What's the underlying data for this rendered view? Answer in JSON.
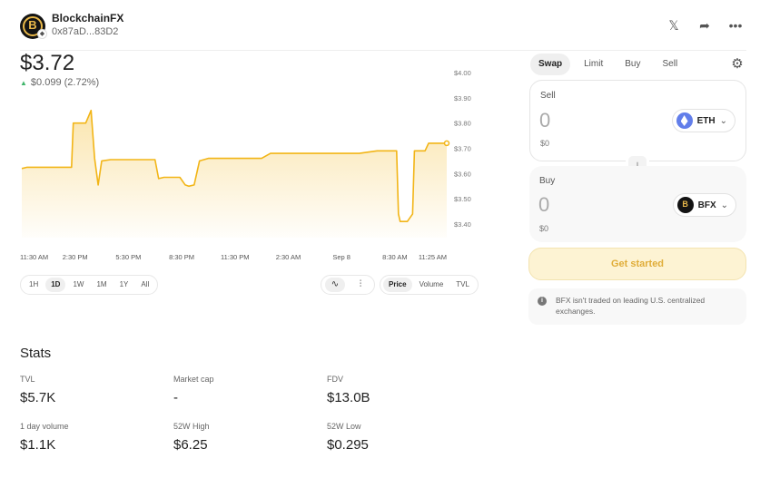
{
  "header": {
    "token_name": "BlockchainFX",
    "token_address": "0x87aD...83D2",
    "logo_letter": "B",
    "icons": [
      "x-icon",
      "share-icon",
      "more-icon"
    ]
  },
  "price": {
    "value": "$3.72",
    "change": "$0.099 (2.72%)",
    "direction": "up",
    "up_color": "#40b66b"
  },
  "chart_data": {
    "type": "area",
    "color": "#f2b517",
    "ylim": [
      3.35,
      4.0
    ],
    "y_ticks": [
      "$4.00",
      "$3.90",
      "$3.80",
      "$3.70",
      "$3.60",
      "$3.50",
      "$3.40"
    ],
    "y_tick_values": [
      4.0,
      3.9,
      3.8,
      3.7,
      3.6,
      3.5,
      3.4
    ],
    "x_ticks": [
      "11:30 AM",
      "2:30 PM",
      "5:30 PM",
      "8:30 PM",
      "11:30 PM",
      "2:30 AM",
      "Sep 8",
      "8:30 AM",
      "11:25 AM"
    ],
    "x_tick_index": [
      0,
      3,
      6,
      9,
      12,
      15,
      18,
      21,
      23.92
    ],
    "series": [
      {
        "x": [
          0,
          0.3,
          0.6,
          2.3,
          2.8,
          2.9,
          3.3,
          3.6,
          3.9,
          4.1,
          4.3,
          4.5,
          5.0,
          5.5,
          6.0,
          7.0,
          7.5,
          7.7,
          8.0,
          8.5,
          8.9,
          9.2,
          9.4,
          9.7,
          10.0,
          10.5,
          11.0,
          12.0,
          13.0,
          13.5,
          14.0,
          14.5,
          15.0,
          16.0,
          17.0,
          18.0,
          18.5,
          19.0,
          19.5,
          20.0,
          20.5,
          21.1,
          21.2,
          21.3,
          21.7,
          22.0,
          22.1,
          22.3,
          22.7,
          22.9,
          23.4,
          23.92
        ],
        "y": [
          3.62,
          3.625,
          3.625,
          3.625,
          3.625,
          3.8,
          3.8,
          3.8,
          3.85,
          3.66,
          3.555,
          3.65,
          3.655,
          3.655,
          3.655,
          3.655,
          3.655,
          3.58,
          3.585,
          3.585,
          3.585,
          3.555,
          3.55,
          3.555,
          3.65,
          3.66,
          3.66,
          3.66,
          3.66,
          3.66,
          3.68,
          3.68,
          3.68,
          3.68,
          3.68,
          3.68,
          3.68,
          3.68,
          3.685,
          3.69,
          3.69,
          3.69,
          3.44,
          3.41,
          3.41,
          3.44,
          3.69,
          3.69,
          3.69,
          3.72,
          3.72,
          3.72
        ]
      }
    ]
  },
  "range_filters": [
    {
      "label": "1H",
      "active": false
    },
    {
      "label": "1D",
      "active": true
    },
    {
      "label": "1W",
      "active": false
    },
    {
      "label": "1M",
      "active": false
    },
    {
      "label": "1Y",
      "active": false
    },
    {
      "label": "All",
      "active": false
    }
  ],
  "chart_types": [
    {
      "icon": "line-chart-icon",
      "glyph": "∿",
      "active": true
    },
    {
      "icon": "candlestick-icon",
      "glyph": "⫶",
      "active": false
    }
  ],
  "metric_filters": [
    {
      "label": "Price",
      "active": true
    },
    {
      "label": "Volume",
      "active": false
    },
    {
      "label": "TVL",
      "active": false
    }
  ],
  "stats": {
    "title": "Stats",
    "items": [
      {
        "label": "TVL",
        "value": "$5.7K"
      },
      {
        "label": "Market cap",
        "value": "-"
      },
      {
        "label": "FDV",
        "value": "$13.0B"
      },
      {
        "label": "1 day volume",
        "value": "$1.1K"
      },
      {
        "label": "52W High",
        "value": "$6.25"
      },
      {
        "label": "52W Low",
        "value": "$0.295"
      }
    ]
  },
  "swap": {
    "tabs": [
      {
        "label": "Swap",
        "active": true
      },
      {
        "label": "Limit",
        "active": false
      },
      {
        "label": "Buy",
        "active": false
      },
      {
        "label": "Sell",
        "active": false
      }
    ],
    "sell": {
      "label": "Sell",
      "amount": "0",
      "usd": "$0",
      "token": "ETH"
    },
    "buy": {
      "label": "Buy",
      "amount": "0",
      "usd": "$0",
      "token": "BFX"
    },
    "cta": "Get started",
    "cta_color": "#e0ad39",
    "notice": "BFX isn't traded on leading U.S. centralized exchanges."
  }
}
